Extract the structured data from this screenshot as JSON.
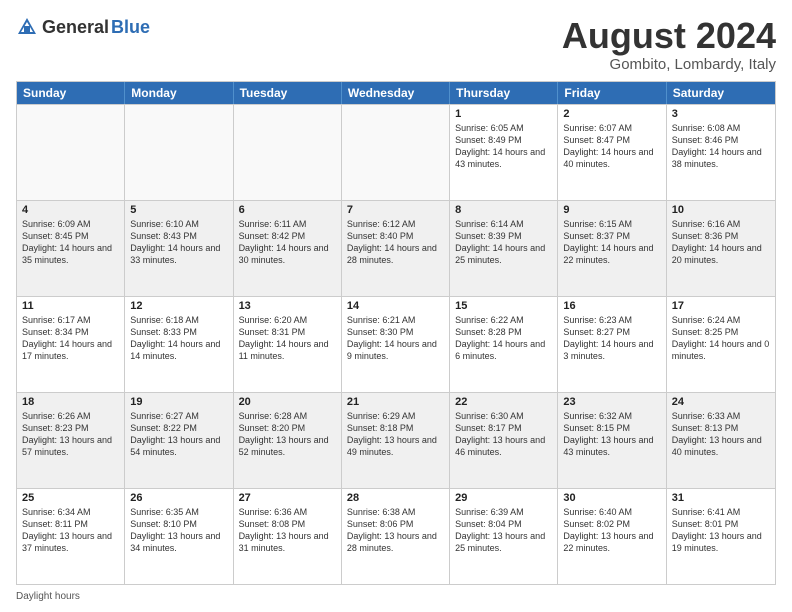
{
  "header": {
    "logo_general": "General",
    "logo_blue": "Blue",
    "title": "August 2024",
    "location": "Gombito, Lombardy, Italy"
  },
  "days_of_week": [
    "Sunday",
    "Monday",
    "Tuesday",
    "Wednesday",
    "Thursday",
    "Friday",
    "Saturday"
  ],
  "footnote": "Daylight hours",
  "weeks": [
    [
      {
        "day": "",
        "info": ""
      },
      {
        "day": "",
        "info": ""
      },
      {
        "day": "",
        "info": ""
      },
      {
        "day": "",
        "info": ""
      },
      {
        "day": "1",
        "info": "Sunrise: 6:05 AM\nSunset: 8:49 PM\nDaylight: 14 hours and 43 minutes."
      },
      {
        "day": "2",
        "info": "Sunrise: 6:07 AM\nSunset: 8:47 PM\nDaylight: 14 hours and 40 minutes."
      },
      {
        "day": "3",
        "info": "Sunrise: 6:08 AM\nSunset: 8:46 PM\nDaylight: 14 hours and 38 minutes."
      }
    ],
    [
      {
        "day": "4",
        "info": "Sunrise: 6:09 AM\nSunset: 8:45 PM\nDaylight: 14 hours and 35 minutes."
      },
      {
        "day": "5",
        "info": "Sunrise: 6:10 AM\nSunset: 8:43 PM\nDaylight: 14 hours and 33 minutes."
      },
      {
        "day": "6",
        "info": "Sunrise: 6:11 AM\nSunset: 8:42 PM\nDaylight: 14 hours and 30 minutes."
      },
      {
        "day": "7",
        "info": "Sunrise: 6:12 AM\nSunset: 8:40 PM\nDaylight: 14 hours and 28 minutes."
      },
      {
        "day": "8",
        "info": "Sunrise: 6:14 AM\nSunset: 8:39 PM\nDaylight: 14 hours and 25 minutes."
      },
      {
        "day": "9",
        "info": "Sunrise: 6:15 AM\nSunset: 8:37 PM\nDaylight: 14 hours and 22 minutes."
      },
      {
        "day": "10",
        "info": "Sunrise: 6:16 AM\nSunset: 8:36 PM\nDaylight: 14 hours and 20 minutes."
      }
    ],
    [
      {
        "day": "11",
        "info": "Sunrise: 6:17 AM\nSunset: 8:34 PM\nDaylight: 14 hours and 17 minutes."
      },
      {
        "day": "12",
        "info": "Sunrise: 6:18 AM\nSunset: 8:33 PM\nDaylight: 14 hours and 14 minutes."
      },
      {
        "day": "13",
        "info": "Sunrise: 6:20 AM\nSunset: 8:31 PM\nDaylight: 14 hours and 11 minutes."
      },
      {
        "day": "14",
        "info": "Sunrise: 6:21 AM\nSunset: 8:30 PM\nDaylight: 14 hours and 9 minutes."
      },
      {
        "day": "15",
        "info": "Sunrise: 6:22 AM\nSunset: 8:28 PM\nDaylight: 14 hours and 6 minutes."
      },
      {
        "day": "16",
        "info": "Sunrise: 6:23 AM\nSunset: 8:27 PM\nDaylight: 14 hours and 3 minutes."
      },
      {
        "day": "17",
        "info": "Sunrise: 6:24 AM\nSunset: 8:25 PM\nDaylight: 14 hours and 0 minutes."
      }
    ],
    [
      {
        "day": "18",
        "info": "Sunrise: 6:26 AM\nSunset: 8:23 PM\nDaylight: 13 hours and 57 minutes."
      },
      {
        "day": "19",
        "info": "Sunrise: 6:27 AM\nSunset: 8:22 PM\nDaylight: 13 hours and 54 minutes."
      },
      {
        "day": "20",
        "info": "Sunrise: 6:28 AM\nSunset: 8:20 PM\nDaylight: 13 hours and 52 minutes."
      },
      {
        "day": "21",
        "info": "Sunrise: 6:29 AM\nSunset: 8:18 PM\nDaylight: 13 hours and 49 minutes."
      },
      {
        "day": "22",
        "info": "Sunrise: 6:30 AM\nSunset: 8:17 PM\nDaylight: 13 hours and 46 minutes."
      },
      {
        "day": "23",
        "info": "Sunrise: 6:32 AM\nSunset: 8:15 PM\nDaylight: 13 hours and 43 minutes."
      },
      {
        "day": "24",
        "info": "Sunrise: 6:33 AM\nSunset: 8:13 PM\nDaylight: 13 hours and 40 minutes."
      }
    ],
    [
      {
        "day": "25",
        "info": "Sunrise: 6:34 AM\nSunset: 8:11 PM\nDaylight: 13 hours and 37 minutes."
      },
      {
        "day": "26",
        "info": "Sunrise: 6:35 AM\nSunset: 8:10 PM\nDaylight: 13 hours and 34 minutes."
      },
      {
        "day": "27",
        "info": "Sunrise: 6:36 AM\nSunset: 8:08 PM\nDaylight: 13 hours and 31 minutes."
      },
      {
        "day": "28",
        "info": "Sunrise: 6:38 AM\nSunset: 8:06 PM\nDaylight: 13 hours and 28 minutes."
      },
      {
        "day": "29",
        "info": "Sunrise: 6:39 AM\nSunset: 8:04 PM\nDaylight: 13 hours and 25 minutes."
      },
      {
        "day": "30",
        "info": "Sunrise: 6:40 AM\nSunset: 8:02 PM\nDaylight: 13 hours and 22 minutes."
      },
      {
        "day": "31",
        "info": "Sunrise: 6:41 AM\nSunset: 8:01 PM\nDaylight: 13 hours and 19 minutes."
      }
    ]
  ]
}
